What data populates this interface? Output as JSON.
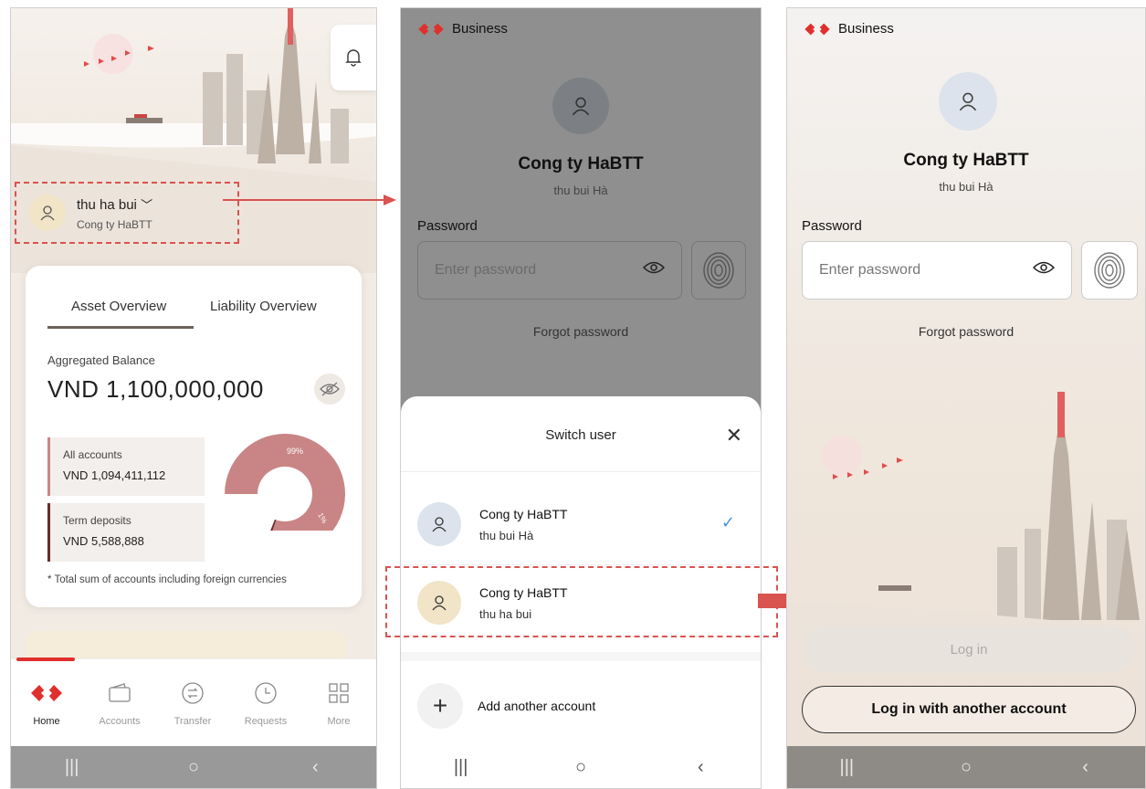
{
  "screen1": {
    "user": {
      "name": "thu ha bui",
      "company": "Cong ty HaBTT"
    },
    "tabs": [
      "Asset Overview",
      "Liability Overview"
    ],
    "aggregated_label": "Aggregated Balance",
    "balance": "VND 1,100,000,000",
    "accounts": [
      {
        "label": "All accounts",
        "value": "VND 1,094,411,112"
      },
      {
        "label": "Term deposits",
        "value": "VND 5,588,888"
      }
    ],
    "donut": {
      "main_pct": "99%",
      "small_pct": "1%",
      "main_fraction": 0.99
    },
    "footnote": "* Total sum of accounts including foreign currencies",
    "bottom_nav": [
      "Home",
      "Accounts",
      "Transfer",
      "Requests",
      "More"
    ]
  },
  "screen2": {
    "brand": "Business",
    "company": "Cong ty HaBTT",
    "username": "thu bui Hà",
    "password_label": "Password",
    "password_placeholder": "Enter password",
    "forgot": "Forgot password",
    "sheet": {
      "title": "Switch user",
      "users": [
        {
          "name": "Cong ty HaBTT",
          "sub": "thu bui Hà",
          "selected": true
        },
        {
          "name": "Cong ty HaBTT",
          "sub": "thu ha bui",
          "selected": false
        }
      ],
      "add": "Add another account"
    }
  },
  "screen3": {
    "brand": "Business",
    "company": "Cong ty HaBTT",
    "username": "thu bui Hà",
    "password_label": "Password",
    "password_placeholder": "Enter password",
    "forgot": "Forgot password",
    "login": "Log in",
    "login_other": "Log in with another account"
  },
  "colors": {
    "accent": "#e0302d",
    "dashed": "#d9534f",
    "donut_main": "#c98585",
    "donut_small": "#6a2c2c"
  }
}
